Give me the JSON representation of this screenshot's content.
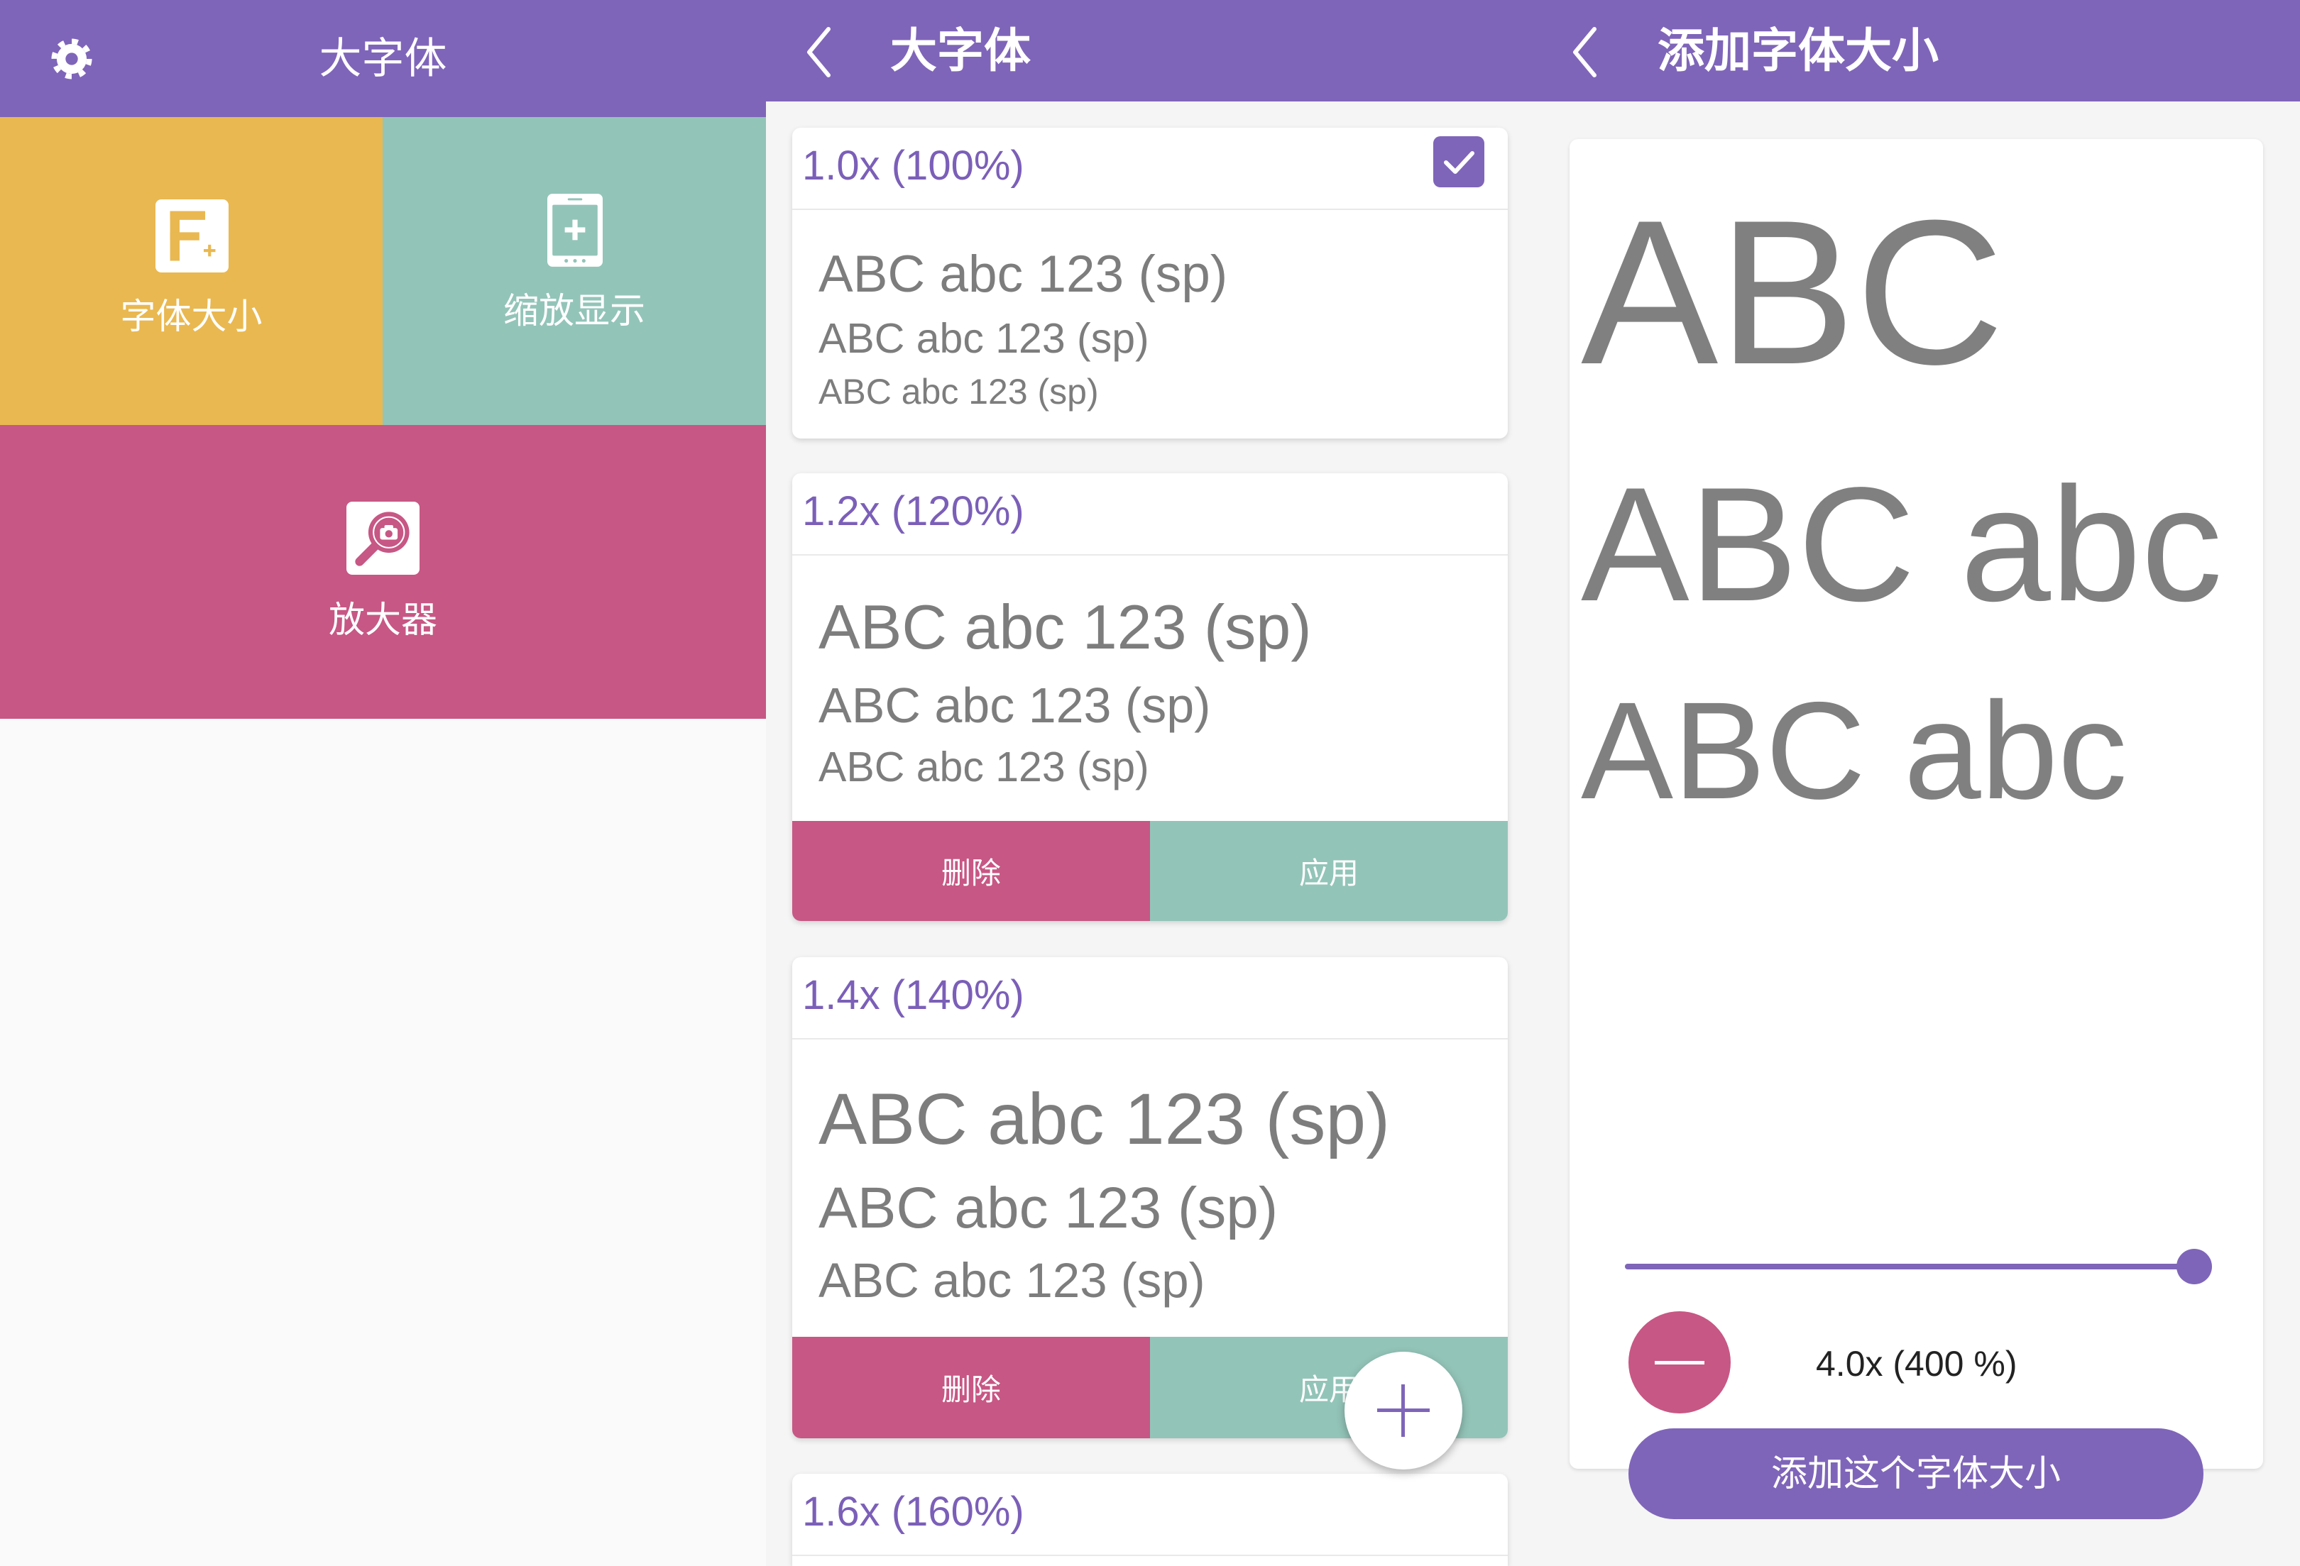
{
  "colors": {
    "primary": "#7f65b9",
    "font_tile": "#e9b850",
    "zoom_tile": "#93c4b8",
    "magnifier_tile": "#c75784",
    "delete": "#c75784",
    "apply": "#93c4b8",
    "card_title": "#7b5fb8",
    "sample_text": "#7d7d7d"
  },
  "home": {
    "title": "大字体",
    "settings_icon": "gear-icon",
    "tiles": [
      {
        "label": "字体大小",
        "icon": "font-size-icon"
      },
      {
        "label": "缩放显示",
        "icon": "display-zoom-icon"
      },
      {
        "label": "放大器",
        "icon": "magnifier-icon"
      }
    ]
  },
  "font_list": {
    "title": "大字体",
    "back_icon": "chevron-left-icon",
    "cards": [
      {
        "scale_label": "1.0x (100%)",
        "checked": true,
        "samples": [
          "ABC abc 123 (sp)",
          "ABC abc 123 (sp)",
          "ABC abc 123 (sp)"
        ]
      },
      {
        "scale_label": "1.2x (120%)",
        "samples": [
          "ABC abc 123 (sp)",
          "ABC abc 123 (sp)",
          "ABC abc 123 (sp)"
        ],
        "delete_label": "删除",
        "apply_label": "应用"
      },
      {
        "scale_label": "1.4x (140%)",
        "samples": [
          "ABC abc 123 (sp)",
          "ABC abc 123 (sp)",
          "ABC abc 123 (sp)"
        ],
        "delete_label": "删除",
        "apply_label": "应用"
      },
      {
        "scale_label": "1.6x (160%)"
      }
    ],
    "fab_icon": "plus-icon"
  },
  "add_size": {
    "title": "添加字体大小",
    "back_icon": "chevron-left-icon",
    "preview_lines": [
      "ABC",
      "ABC abc",
      "ABC abc"
    ],
    "slider": {
      "level": 1.0
    },
    "decrease_icon": "minus-icon",
    "value_label": "4.0x (400 %)",
    "add_button_label": "添加这个字体大小"
  }
}
